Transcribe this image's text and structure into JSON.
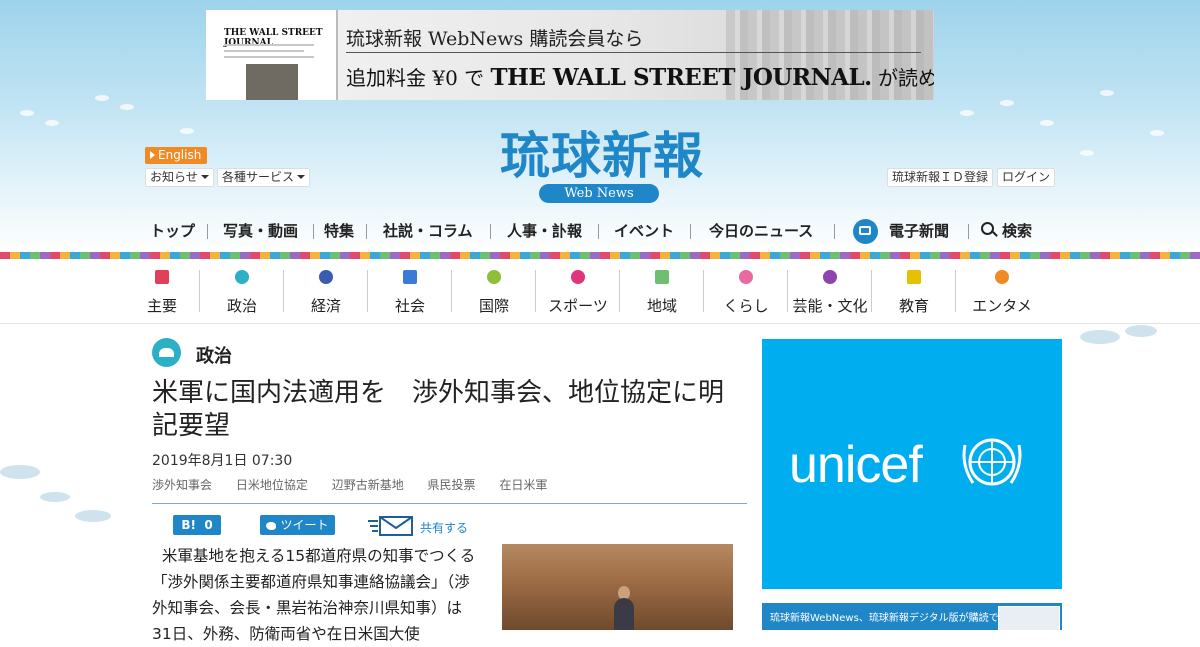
{
  "banner": {
    "paper_title": "THE WALL STREET JOURNAL",
    "line1": "琉球新報 WebNews 購読会員なら",
    "line2_prefix": "追加料金 ¥0 で",
    "line2_brand": "THE WALL STREET JOURNAL.",
    "line2_suffix": "が読める"
  },
  "header": {
    "english": "English",
    "notice": "お知らせ",
    "services": "各種サービス",
    "logo": "琉球新報",
    "logo_sub": "Web News",
    "register": "琉球新報ＩＤ登録",
    "login": "ログイン"
  },
  "topnav": {
    "items": [
      "トップ",
      "写真・動画",
      "特集",
      "社説・コラム",
      "人事・訃報",
      "イベント",
      "今日のニュース",
      "電子新聞",
      "検索"
    ]
  },
  "categories": [
    {
      "label": "主要",
      "icon": "flag-icon",
      "color": "#e1405a"
    },
    {
      "label": "政治",
      "icon": "parliament-icon",
      "color": "#2bb0c5"
    },
    {
      "label": "経済",
      "icon": "chart-icon",
      "color": "#3b5bb0"
    },
    {
      "label": "社会",
      "icon": "people-icon",
      "color": "#3a7bd5"
    },
    {
      "label": "国際",
      "icon": "globe-icon",
      "color": "#8fbf3a"
    },
    {
      "label": "スポーツ",
      "icon": "runner-icon",
      "color": "#e0357a"
    },
    {
      "label": "地域",
      "icon": "pin-icon",
      "color": "#6cc070"
    },
    {
      "label": "くらし",
      "icon": "house-icon",
      "color": "#e86aa0"
    },
    {
      "label": "芸能・文化",
      "icon": "brush-icon",
      "color": "#8e44ad"
    },
    {
      "label": "教育",
      "icon": "graduation-icon",
      "color": "#e5c100"
    },
    {
      "label": "エンタメ",
      "icon": "tv-icon",
      "color": "#f08a24"
    }
  ],
  "article": {
    "category": "政治",
    "headline": "米軍に国内法適用を　渉外知事会、地位協定に明記要望",
    "date": "2019年8月1日 07:30",
    "tags": [
      "渉外知事会",
      "日米地位協定",
      "辺野古新基地",
      "県民投票",
      "在日米軍"
    ],
    "hatena_label": "B!",
    "hatena_count": "0",
    "tweet": "ツイート",
    "share": "共有する",
    "body": "米軍基地を抱える15都道府県の知事でつくる「渉外関係主要都道府県知事連絡協議会」（渉外知事会、会長・黒岩祐治神奈川県知事）は31日、外務、防衛両省や在日米国大使"
  },
  "sidebar": {
    "ad_brand": "unicef",
    "ad2_text": "琉球新報WebNews、琉球新報デジタル版が購読できる"
  },
  "colors": {
    "brand_blue": "#1f86c8",
    "english_orange": "#f08a24",
    "unicef_blue": "#00aeef",
    "politics_teal": "#2bb0c5"
  }
}
